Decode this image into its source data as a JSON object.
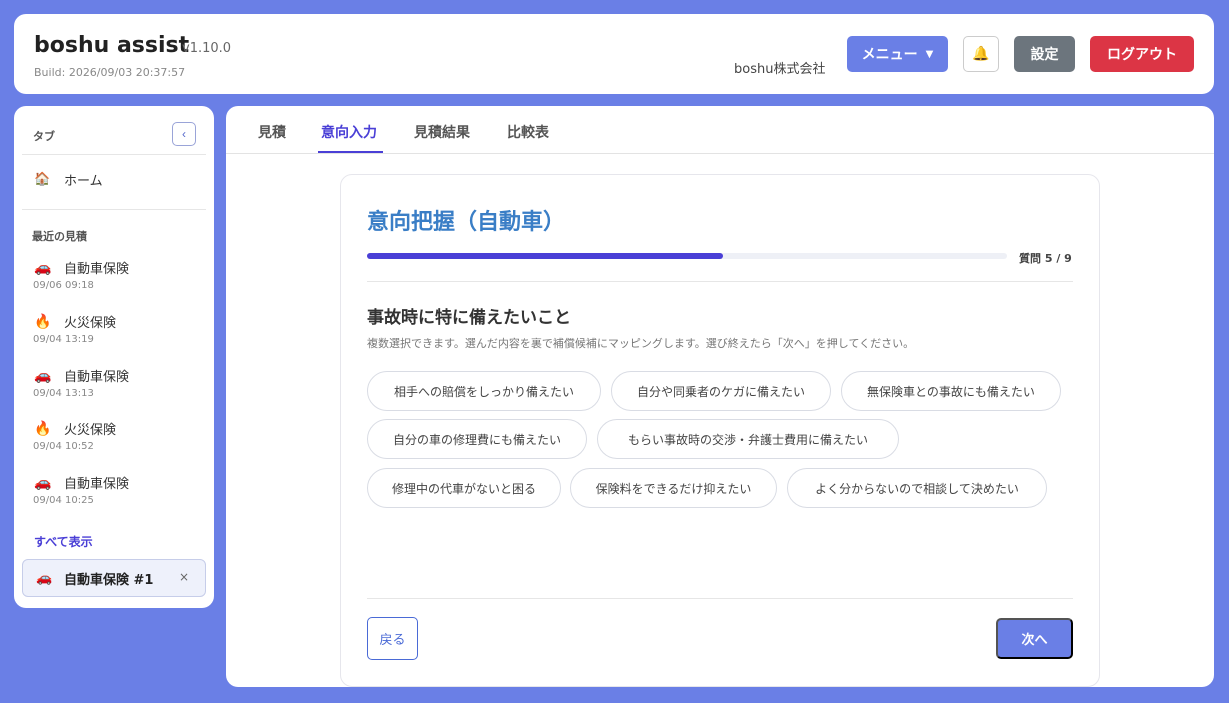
{
  "header": {
    "title": "boshu assist",
    "version": "v1.10.0",
    "build": "Build: 2026/09/03 20:37:57",
    "company": "boshu株式会社",
    "menu_label": "メニュー",
    "menu_caret": "▼",
    "bell_icon": "🔔",
    "settings_label": "設定",
    "logout_label": "ログアウト"
  },
  "sidebar": {
    "heading": "タブ",
    "collapse_icon": "‹",
    "home": {
      "icon": "🏠",
      "label": "ホーム"
    },
    "recent_heading": "最近の見積",
    "recent": [
      {
        "icon": "🚗",
        "label": "自動車保険",
        "time": "09/06 09:18"
      },
      {
        "icon": "🔥",
        "label": "火災保険",
        "time": "09/04 13:19"
      },
      {
        "icon": "🚗",
        "label": "自動車保険",
        "time": "09/04 13:13"
      },
      {
        "icon": "🔥",
        "label": "火災保険",
        "time": "09/04 10:52"
      },
      {
        "icon": "🚗",
        "label": "自動車保険",
        "time": "09/04 10:25"
      }
    ],
    "show_all": "すべて表示",
    "open_tab": {
      "icon": "🚗",
      "label": "自動車保険 #1",
      "close": "×"
    }
  },
  "main": {
    "tabs": [
      {
        "label": "見積",
        "active": false
      },
      {
        "label": "意向入力",
        "active": true
      },
      {
        "label": "見積結果",
        "active": false
      },
      {
        "label": "比較表",
        "active": false
      }
    ],
    "card": {
      "title": "意向把握（自動車）",
      "progress": {
        "current": 5,
        "total": 9,
        "text": "質問 5 / 9"
      },
      "question_title": "事故時に特に備えたいこと",
      "question_desc": "複数選択できます。選んだ内容を裏で補償候補にマッピングします。選び終えたら「次へ」を押してください。",
      "options": [
        "相手への賠償をしっかり備えたい",
        "自分や同乗者のケガに備えたい",
        "無保険車との事故にも備えたい",
        "自分の車の修理費にも備えたい",
        "もらい事故時の交渉・弁護士費用に備えたい",
        "修理中の代車がないと困る",
        "保険料をできるだけ抑えたい",
        "よく分からないので相談して決めたい"
      ],
      "back_label": "戻る",
      "next_label": "次へ"
    }
  },
  "colors": {
    "background": "#6a7fe6",
    "accent": "#4a3fd6",
    "title_blue": "#3a7ec6",
    "logout_red": "#dc3545",
    "settings_gray": "#6c757d"
  }
}
